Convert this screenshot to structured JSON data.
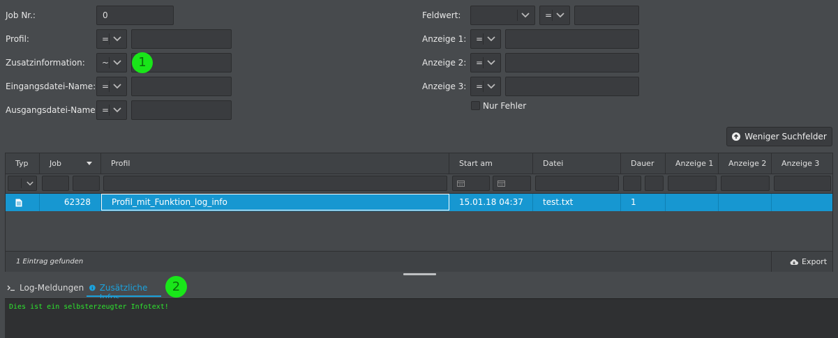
{
  "form_left": {
    "job_nr": {
      "label": "Job Nr.:",
      "value": "0"
    },
    "profil": {
      "label": "Profil:",
      "operator": "=",
      "value": ""
    },
    "zusatzinformation": {
      "label": "Zusatzinformation:",
      "operator": "~",
      "value": ""
    },
    "eingangsdatei": {
      "label": "Eingangsdatei-Name:",
      "operator": "=",
      "value": ""
    },
    "ausgangsdatei": {
      "label": "Ausgangsdatei-Name:",
      "operator": "=",
      "value": ""
    }
  },
  "form_right": {
    "feldwert": {
      "label": "Feldwert:",
      "field": "",
      "operator": "=",
      "value": ""
    },
    "anzeige1": {
      "label": "Anzeige 1:",
      "operator": "=",
      "value": ""
    },
    "anzeige2": {
      "label": "Anzeige 2:",
      "operator": "=",
      "value": ""
    },
    "anzeige3": {
      "label": "Anzeige 3:",
      "operator": "=",
      "value": ""
    },
    "nur_fehler": {
      "label": "Nur Fehler",
      "checked": false
    }
  },
  "less_fields_button": "Weniger Suchfelder",
  "table": {
    "columns": [
      "Typ",
      "Job",
      "Profil",
      "Start am",
      "Datei",
      "Dauer",
      "Anzeige 1",
      "Anzeige 2",
      "Anzeige 3"
    ],
    "rows": [
      {
        "typ_icon": "document-icon",
        "job": "62328",
        "profil": "Profil_mit_Funktion_log_info",
        "start": "15.01.18 04:37",
        "datei": "test.txt",
        "dauer": "1",
        "anzeige1": "",
        "anzeige2": "",
        "anzeige3": ""
      }
    ],
    "footer_count": "1 Eintrag gefunden",
    "export_label": "Export"
  },
  "annotations": {
    "marker1": "1",
    "marker2": "2"
  },
  "tabs": [
    {
      "label": "Log-Meldungen",
      "icon": "terminal-icon",
      "active": false
    },
    {
      "label": "Zusätzliche Infos",
      "icon": "info-icon",
      "active": true
    }
  ],
  "console_text": "Dies ist ein selbsterzeugter Infotext!",
  "colors": {
    "accent": "#1797d1",
    "console_text": "#2ee62e",
    "marker": "#19e619"
  }
}
